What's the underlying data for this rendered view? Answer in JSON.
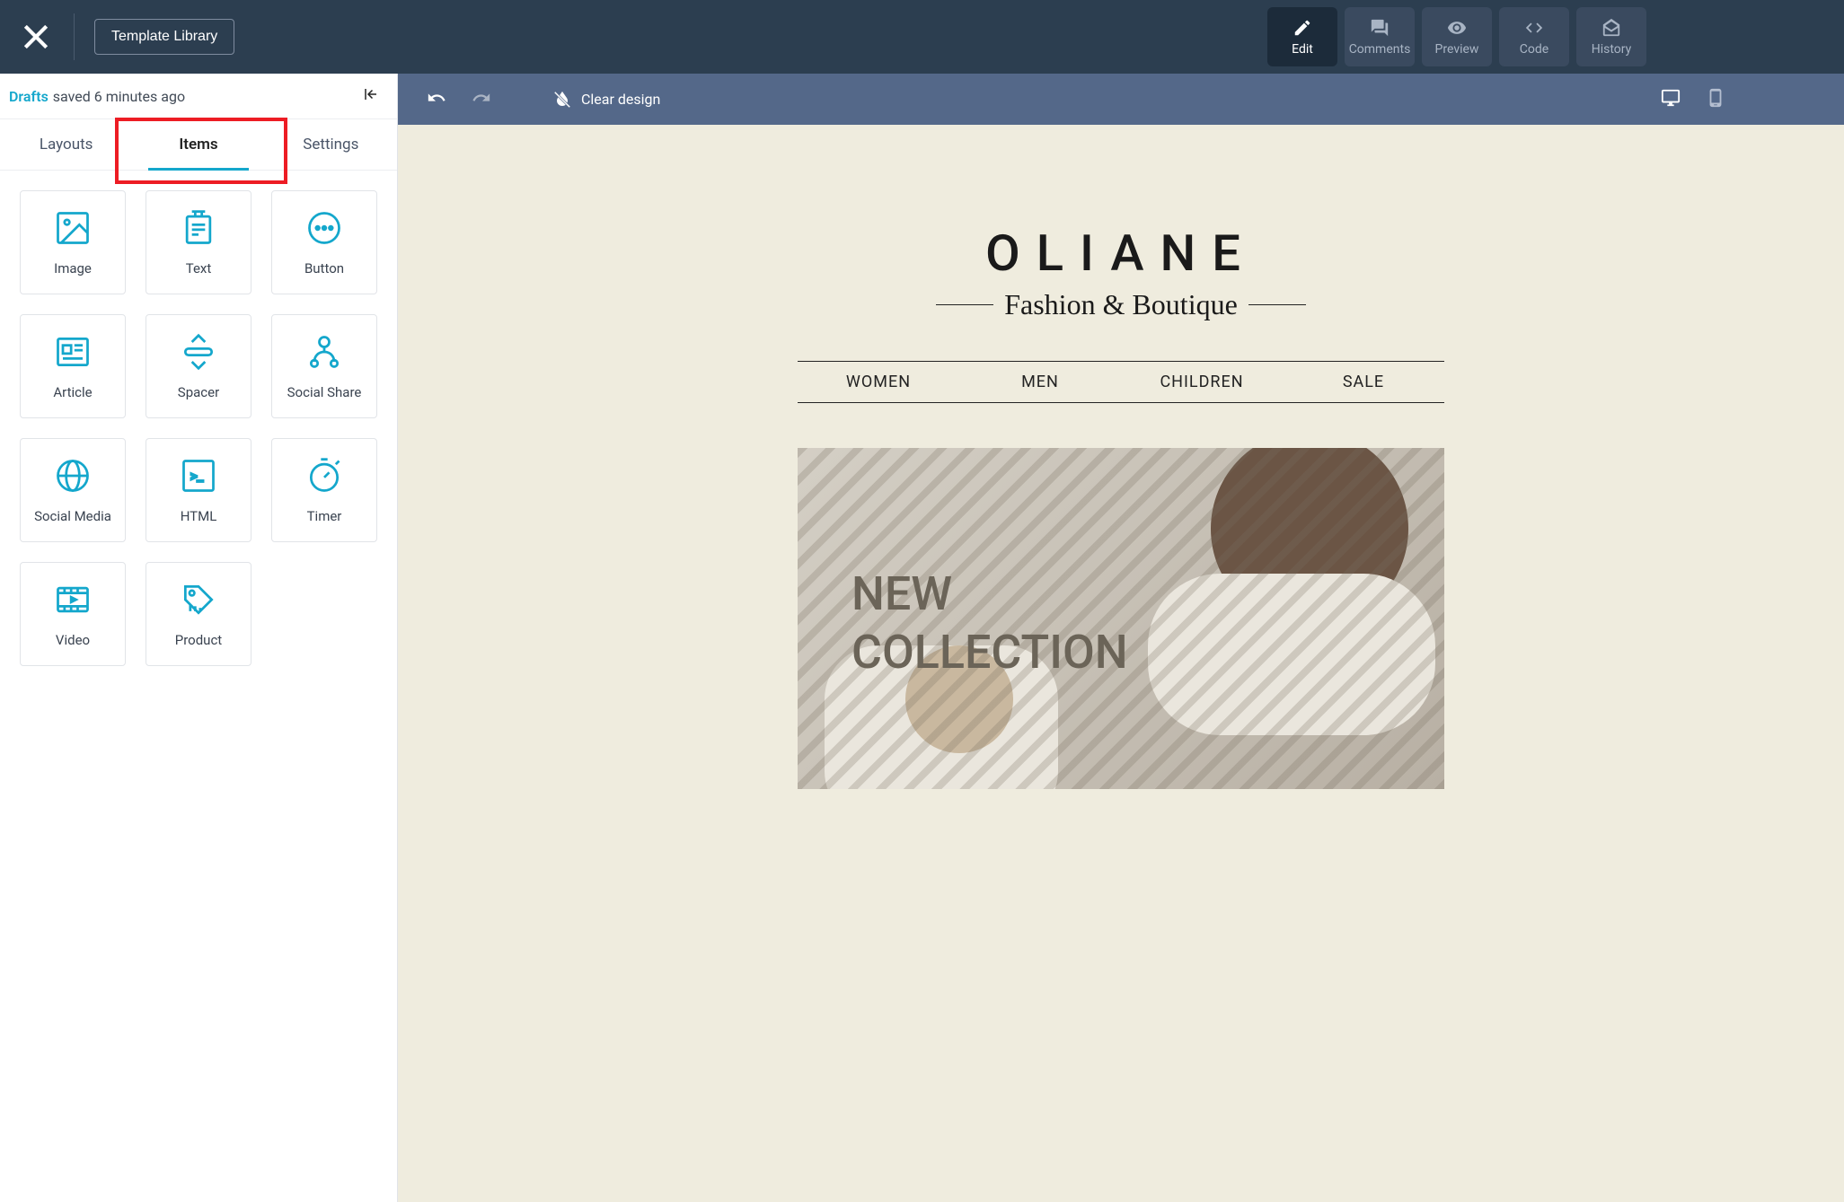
{
  "topbar": {
    "template_library": "Template Library",
    "modes": {
      "edit": "Edit",
      "comments": "Comments",
      "preview": "Preview",
      "code": "Code",
      "history": "History"
    }
  },
  "left": {
    "drafts_link": "Drafts",
    "drafts_status": "saved 6 minutes ago",
    "tabs": {
      "layouts": "Layouts",
      "items": "Items",
      "settings": "Settings"
    },
    "items": {
      "image": "Image",
      "text": "Text",
      "button": "Button",
      "article": "Article",
      "spacer": "Spacer",
      "social_share": "Social Share",
      "social_media": "Social Media",
      "html": "HTML",
      "timer": "Timer",
      "video": "Video",
      "product": "Product"
    }
  },
  "canvas_bar": {
    "clear_design": "Clear design"
  },
  "preview": {
    "logo": "OLIANE",
    "tagline": "Fashion & Boutique",
    "nav": {
      "women": "WOMEN",
      "men": "MEN",
      "children": "CHILDREN",
      "sale": "SALE"
    },
    "hero_line1": "NEW",
    "hero_line2": "COLLECTION"
  },
  "colors": {
    "accent": "#14a7cc",
    "topbar_bg": "#2c3e50",
    "canvas_bar_bg": "#546889",
    "canvas_bg": "#efecde",
    "highlight_box": "#ed1c24"
  }
}
